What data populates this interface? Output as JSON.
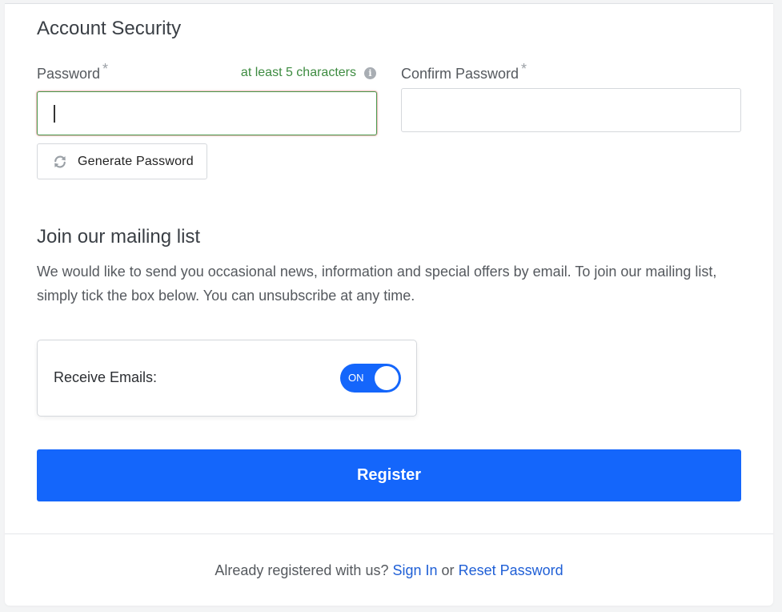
{
  "account_security": {
    "title": "Account Security",
    "password": {
      "label": "Password",
      "required_mark": "*",
      "hint": "at least 5 characters",
      "value": "",
      "placeholder": ""
    },
    "confirm_password": {
      "label": "Confirm Password",
      "required_mark": "*",
      "value": "",
      "placeholder": ""
    },
    "generate_button": {
      "label": "Generate Password",
      "icon": "refresh-icon"
    },
    "info_icon": "info-icon"
  },
  "mailing_list": {
    "title": "Join our mailing list",
    "description": "We would like to send you occasional news, information and special offers by email. To join our mailing list, simply tick the box below. You can unsubscribe at any time.",
    "receive_emails": {
      "label": "Receive Emails:",
      "toggle_state": "ON"
    }
  },
  "register_button": {
    "label": "Register"
  },
  "footer": {
    "prefix": "Already registered with us?",
    "sign_in_label": "Sign In",
    "or_text": "or",
    "reset_label": "Reset Password"
  },
  "colors": {
    "primary": "#1466fb",
    "hint_green": "#3d8b40",
    "link": "#1f5fd6",
    "focus_border": "#4a9a4e"
  }
}
